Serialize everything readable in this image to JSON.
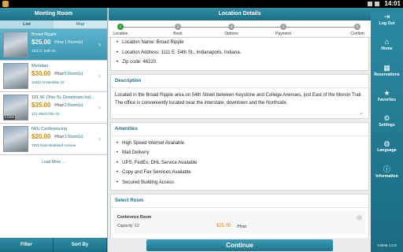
{
  "status_bar": {
    "time": "14:01"
  },
  "left_panel": {
    "title": "Meeting Room",
    "tabs": [
      "List",
      "Map"
    ],
    "rooms": [
      {
        "name": "Broad Ripple",
        "price": "$25.00",
        "unit": "/Hour",
        "rooms": "1 Room(s)",
        "address": "1111 E. 54th St.",
        "distance": ""
      },
      {
        "name": "Meridian",
        "price": "$30.00",
        "unit": "/Hour",
        "rooms": "5 Room(s)",
        "address": "10401 N Meridian St",
        "distance": ""
      },
      {
        "name": "101 W. Ohio St. Downtown Ind...",
        "price": "$35.00",
        "unit": "/Hour",
        "rooms": "2 Room(s)",
        "address": "101 West Ohio St.",
        "distance": "5.93KM"
      },
      {
        "name": "IWU Conferencing",
        "price": "$20.00",
        "unit": "/Hour",
        "rooms": "1 Room(s)",
        "address": "7915 East Markland Avenue",
        "distance": ""
      }
    ],
    "load_more": "Load More ...",
    "footer": {
      "filter": "Filter",
      "sort": "Sort By"
    }
  },
  "main": {
    "title": "Location Details",
    "steps": [
      {
        "num": "1",
        "label": "Location",
        "active": true
      },
      {
        "num": "2",
        "label": "Book",
        "active": false
      },
      {
        "num": "3",
        "label": "Options",
        "active": false
      },
      {
        "num": "4",
        "label": "Payment",
        "active": false
      },
      {
        "num": "5",
        "label": "Confirm",
        "active": false
      }
    ],
    "location_info": [
      "Location Name: Broad Ripple",
      "Location Address: 1111 E. 54th St., Indianapolis, Indiana.",
      "Zip code: 46220."
    ],
    "description_title": "Description",
    "description": "Located in the Broad Ripple area on 54th Street between Keystone and College Avenues, just East of the Monon Trail. The office is conveniently located near the interstate, downtown and the Northside.",
    "amenities_title": "Amenities",
    "amenities": [
      "High Speed Internet Available",
      "Mail Delivery",
      "UPS, FedEx, DHL Service Available",
      "Copy and Fax Services Available",
      "Secured Building Access"
    ],
    "select_room_title": "Select Room",
    "select_room": {
      "name": "Conference Room",
      "capacity": "Capacity :12",
      "price": "$25.00",
      "unit": "/Hour"
    },
    "continue_label": "Continue"
  },
  "right_nav": {
    "items": [
      {
        "label": "Log Out",
        "icon": "logout-icon"
      },
      {
        "label": "Home",
        "icon": "home-icon"
      },
      {
        "label": "Reservations",
        "icon": "calendar-icon"
      },
      {
        "label": "Favorites",
        "icon": "star-icon"
      },
      {
        "label": "Settings",
        "icon": "gear-icon"
      },
      {
        "label": "Language",
        "icon": "globe-icon"
      },
      {
        "label": "Information",
        "icon": "info-icon"
      }
    ],
    "version": "V.Beta 1.0.9"
  },
  "colors": {
    "brand": "#1c6f86",
    "price": "#d98a00",
    "step_active": "#2c9a3a"
  }
}
